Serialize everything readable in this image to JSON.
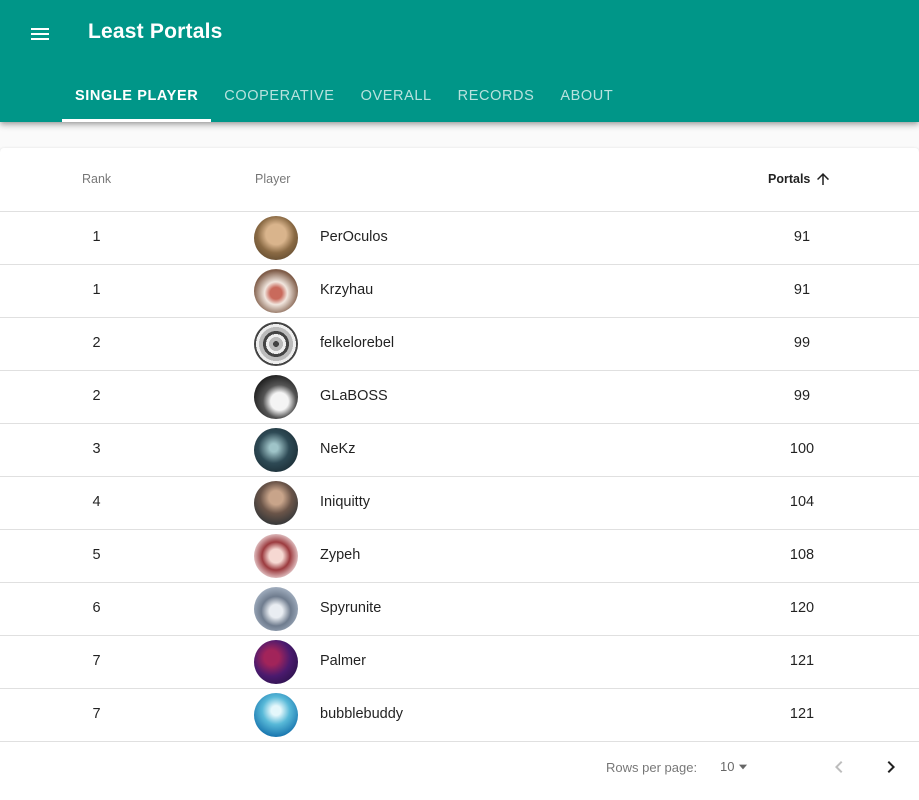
{
  "app": {
    "title": "Least Portals"
  },
  "tabs": [
    {
      "label": "SINGLE PLAYER",
      "active": true
    },
    {
      "label": "COOPERATIVE",
      "active": false
    },
    {
      "label": "OVERALL",
      "active": false
    },
    {
      "label": "RECORDS",
      "active": false
    },
    {
      "label": "ABOUT",
      "active": false
    }
  ],
  "table": {
    "headers": {
      "rank": "Rank",
      "player": "Player",
      "portals": "Portals"
    },
    "sort": {
      "column": "portals",
      "direction": "ascending"
    },
    "rows": [
      {
        "rank": "1",
        "player": "PerOculos",
        "portals": "91"
      },
      {
        "rank": "1",
        "player": "Krzyhau",
        "portals": "91"
      },
      {
        "rank": "2",
        "player": "felkelorebel",
        "portals": "99"
      },
      {
        "rank": "2",
        "player": "GLaBOSS",
        "portals": "99"
      },
      {
        "rank": "3",
        "player": "NeKz",
        "portals": "100"
      },
      {
        "rank": "4",
        "player": "Iniquitty",
        "portals": "104"
      },
      {
        "rank": "5",
        "player": "Zypeh",
        "portals": "108"
      },
      {
        "rank": "6",
        "player": "Spyrunite",
        "portals": "120"
      },
      {
        "rank": "7",
        "player": "Palmer",
        "portals": "121"
      },
      {
        "rank": "7",
        "player": "bubblebuddy",
        "portals": "121"
      }
    ]
  },
  "pagination": {
    "rows_per_page_label": "Rows per page:",
    "rows_per_page_value": "10",
    "prev_enabled": false,
    "next_enabled": true
  },
  "colors": {
    "primary": "#009688",
    "text": "#212121",
    "divider": "#e0e0e0"
  },
  "icons": {
    "menu": "menu-icon",
    "sort": "arrow-up-icon",
    "dropdown": "caret-down-icon",
    "prev": "chevron-left-icon",
    "next": "chevron-right-icon"
  }
}
